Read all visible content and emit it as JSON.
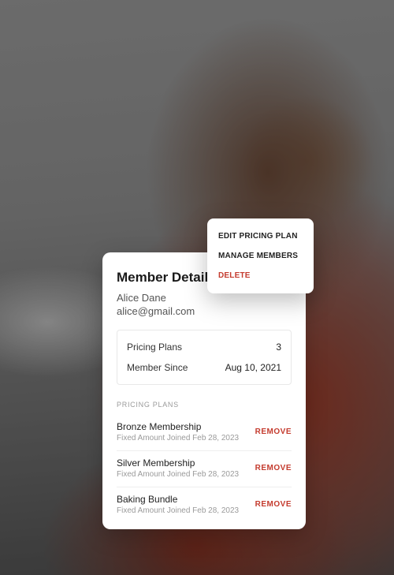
{
  "menu": {
    "edit": "EDIT PRICING PLAN",
    "manage": "MANAGE MEMBERS",
    "delete": "DELETE"
  },
  "card": {
    "title": "Member Details",
    "name": "Alice Dane",
    "email": "alice@gmail.com",
    "stats": {
      "plans_label": "Pricing Plans",
      "plans_value": "3",
      "since_label": "Member Since",
      "since_value": "Aug 10, 2021"
    },
    "section_header": "PRICING PLANS",
    "remove_label": "REMOVE",
    "plans": [
      {
        "name": "Bronze Membership",
        "meta": "Fixed Amount  Joined Feb 28, 2023"
      },
      {
        "name": "Silver Membership",
        "meta": "Fixed Amount  Joined Feb 28, 2023"
      },
      {
        "name": "Baking Bundle",
        "meta": "Fixed Amount  Joined Feb 28, 2023"
      }
    ]
  }
}
